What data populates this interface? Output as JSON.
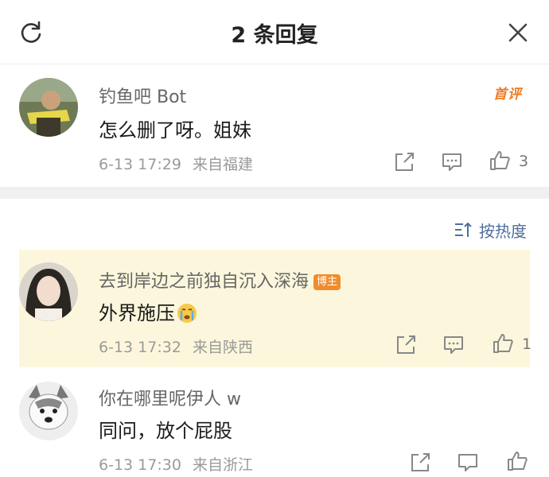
{
  "header": {
    "title": "2 条回复",
    "refresh_icon": "refresh-icon",
    "close_icon": "close-icon"
  },
  "first_comment": {
    "username": "钓鱼吧 Bot",
    "text": "怎么删了呀。姐妹",
    "date": "6-13 17:29",
    "location": "来自福建",
    "likes": "3",
    "badge": "首评"
  },
  "sort": {
    "label": "按热度",
    "icon": "sort-icon"
  },
  "replies": [
    {
      "username": "去到岸边之前独自沉入深海",
      "badge": "博主",
      "text": "外界施压",
      "emoji": "crying-face-emoji",
      "date": "6-13 17:32",
      "location": "来自陕西",
      "likes": "1",
      "highlighted": true
    },
    {
      "username": "你在哪里呢伊人 w",
      "text": "同问，放个屁股",
      "date": "6-13 17:30",
      "location": "来自浙江",
      "likes": ""
    }
  ],
  "colors": {
    "accent_link": "#4e6f9c",
    "badge_orange": "#f08c2b",
    "highlight_bg": "#fcf7dc",
    "meta_gray": "#9a9a9a"
  }
}
